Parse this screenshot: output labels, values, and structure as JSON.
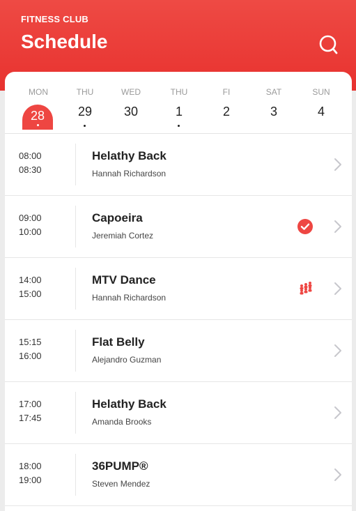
{
  "header": {
    "brand": "FITNESS CLUB",
    "title": "Schedule",
    "icon": "search-icon",
    "color": "#e8322f"
  },
  "days": [
    {
      "name": "MON",
      "num": "28",
      "selected": true,
      "dot": true
    },
    {
      "name": "THU",
      "num": "29",
      "selected": false,
      "dot": true
    },
    {
      "name": "WED",
      "num": "30",
      "selected": false,
      "dot": false
    },
    {
      "name": "THU",
      "num": "1",
      "selected": false,
      "dot": true
    },
    {
      "name": "FI",
      "num": "2",
      "selected": false,
      "dot": false
    },
    {
      "name": "SAT",
      "num": "3",
      "selected": false,
      "dot": false
    },
    {
      "name": "SUN",
      "num": "4",
      "selected": false,
      "dot": false
    }
  ],
  "classes": [
    {
      "start": "08:00",
      "end": "08:30",
      "name": "Helathy Back",
      "trainer": "Hannah Richardson",
      "status": ""
    },
    {
      "start": "09:00",
      "end": "10:00",
      "name": "Capoeira",
      "trainer": "Jeremiah Cortez",
      "status": "check-icon"
    },
    {
      "start": "14:00",
      "end": "15:00",
      "name": "MTV Dance",
      "trainer": "Hannah Richardson",
      "status": "group-icon"
    },
    {
      "start": "15:15",
      "end": "16:00",
      "name": "Flat Belly",
      "trainer": "Alejandro Guzman",
      "status": ""
    },
    {
      "start": "17:00",
      "end": "17:45",
      "name": "Helathy Back",
      "trainer": "Amanda Brooks",
      "status": ""
    },
    {
      "start": "18:00",
      "end": "19:00",
      "name": "36PUMP®",
      "trainer": "Steven Mendez",
      "status": ""
    }
  ],
  "colors": {
    "accent": "#ee4642",
    "chevron": "#c7c7cc"
  }
}
